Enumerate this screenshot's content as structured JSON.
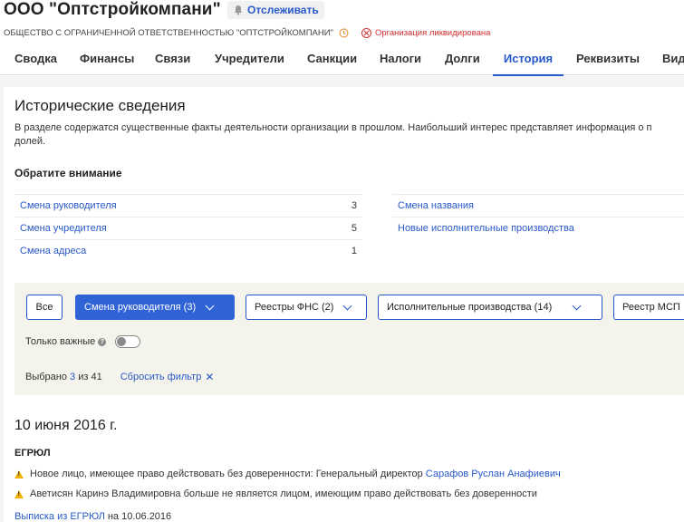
{
  "header": {
    "title": "ООО \"Оптстройкомпани\"",
    "track_label": "Отслеживать",
    "full_name": "ОБЩЕСТВО С ОГРАНИЧЕННОЙ ОТВЕТСТВЕННОСТЬЮ \"ОПТСТРОЙКОМПАНИ\"",
    "status": "Организация ликвидирована",
    "status_color": "#d32f2f"
  },
  "tabs": [
    {
      "label": "Сводка"
    },
    {
      "label": "Финансы"
    },
    {
      "label": "Связи"
    },
    {
      "label": "Учредители"
    },
    {
      "label": "Санкции"
    },
    {
      "label": "Налоги"
    },
    {
      "label": "Долги"
    },
    {
      "label": "История",
      "active": true
    },
    {
      "label": "Реквизиты"
    },
    {
      "label": "Вид"
    }
  ],
  "history": {
    "title": "Исторические сведения",
    "description": "В разделе содержатся существенные факты деятельности организации в прошлом. Наибольший интерес представляет информация о п долей.",
    "attention_title": "Обратите внимание",
    "stats_left": [
      {
        "label": "Смена руководителя",
        "count": "3"
      },
      {
        "label": "Смена учредителя",
        "count": "5"
      },
      {
        "label": "Смена адреса",
        "count": "1"
      }
    ],
    "stats_right": [
      {
        "label": "Смена названия"
      },
      {
        "label": "Новые исполнительные производства"
      }
    ]
  },
  "filters": {
    "buttons": [
      {
        "label": "Все"
      },
      {
        "label": "Смена руководителя (3)",
        "active": true
      },
      {
        "label": "Реестры ФНС (2)"
      },
      {
        "label": "Исполнительные производства (14)"
      },
      {
        "label": "Реестр МСП"
      }
    ],
    "important_label": "Только важные",
    "important_on": false,
    "selected_prefix": "Выбрано",
    "selected_count": "3",
    "selected_of": "из 41",
    "reset_label": "Сбросить фильтр"
  },
  "timeline": {
    "date": "10 июня 2016 г.",
    "source": "ЕГРЮЛ",
    "events": [
      {
        "text": "Новое лицо, имеющее право действовать без доверенности: Генеральный директор ",
        "link": "Сарафов Руслан Анафиевич"
      },
      {
        "text": "Аветисян Каринэ Владимировна больше не является лицом, имеющим право действовать без доверенности",
        "link": ""
      }
    ],
    "extract_link": "Выписка из ЕГРЮЛ",
    "extract_date": "на 10.06.2016"
  },
  "colors": {
    "accent": "#2758c8",
    "active_filter": "#2f63d6",
    "filter_panel_bg": "#f4f4ec",
    "warning": "#f2b300"
  }
}
